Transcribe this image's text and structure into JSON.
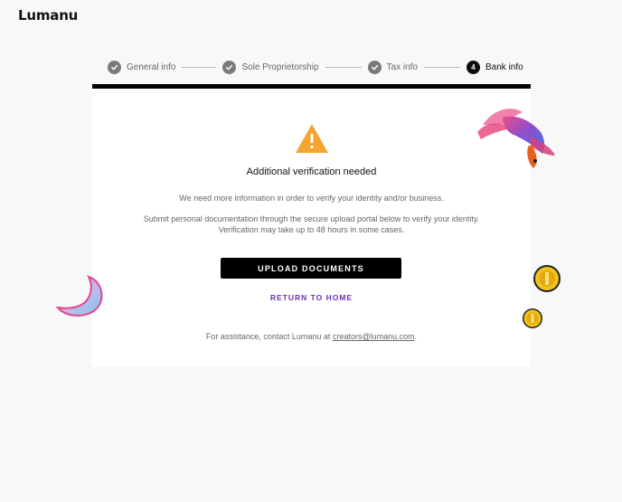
{
  "brand": {
    "logo_text": "Lumanu"
  },
  "stepper": {
    "steps": [
      {
        "label": "General info",
        "state": "complete"
      },
      {
        "label": "Sole Proprietorship",
        "state": "complete"
      },
      {
        "label": "Tax info",
        "state": "complete"
      },
      {
        "label": "Bank info",
        "state": "active",
        "number": "4"
      }
    ]
  },
  "card": {
    "icon": "warning-icon",
    "title": "Additional verification needed",
    "message_primary": "We need more information in order to verify your identity and/or business.",
    "message_secondary": "Submit personal documentation through the secure upload portal below to verify your identity. Verification may take up to 48 hours in some cases.",
    "upload_button_label": "UPLOAD DOCUMENTS",
    "return_link_label": "RETURN TO HOME",
    "assistance_prefix": "For assistance, contact Lumanu at",
    "assistance_email": "creators@lumanu.com",
    "assistance_suffix": "."
  },
  "colors": {
    "accent_purple": "#6b31b9",
    "warning_orange": "#f7a532",
    "card_top_border": "#000000"
  }
}
